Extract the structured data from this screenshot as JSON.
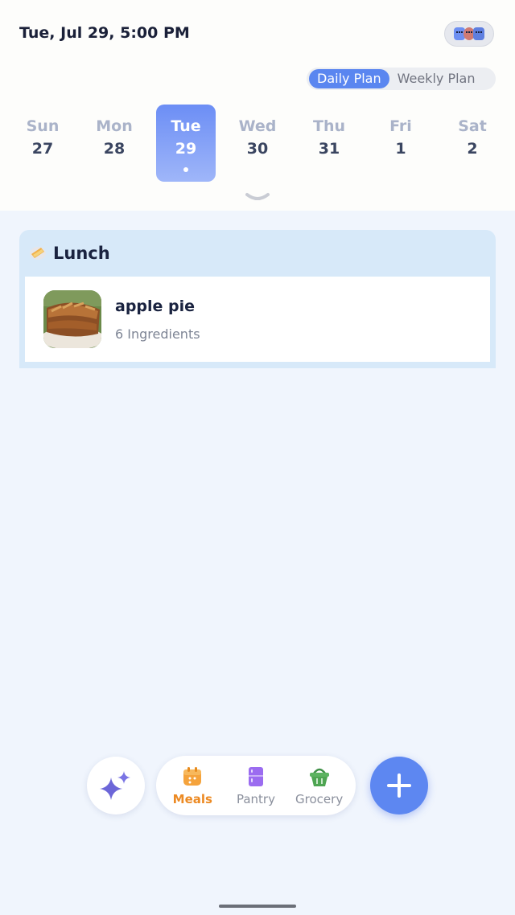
{
  "header": {
    "datetime": "Tue, Jul 29, 5:00 PM"
  },
  "plan_toggle": {
    "options": [
      "Daily Plan",
      "Weekly Plan"
    ],
    "selected": "Daily Plan"
  },
  "week": {
    "days": [
      {
        "name": "Sun",
        "num": "27"
      },
      {
        "name": "Mon",
        "num": "28"
      },
      {
        "name": "Tue",
        "num": "29"
      },
      {
        "name": "Wed",
        "num": "30"
      },
      {
        "name": "Thu",
        "num": "31"
      },
      {
        "name": "Fri",
        "num": "1"
      },
      {
        "name": "Sat",
        "num": "2"
      }
    ],
    "selected_index": 2
  },
  "meal_section": {
    "title": "Lunch",
    "items": [
      {
        "name": "apple pie",
        "subtitle": "6 Ingredients"
      }
    ]
  },
  "tabbar": {
    "tabs": [
      {
        "label": "Meals",
        "icon": "calendar-icon",
        "active": true
      },
      {
        "label": "Pantry",
        "icon": "fridge-icon",
        "active": false
      },
      {
        "label": "Grocery",
        "icon": "basket-icon",
        "active": false
      }
    ]
  },
  "colors": {
    "accent": "#5d87f1",
    "active_tab": "#ec8a23",
    "background": "#f0f5fd",
    "meal_card": "#d7e9f9"
  }
}
